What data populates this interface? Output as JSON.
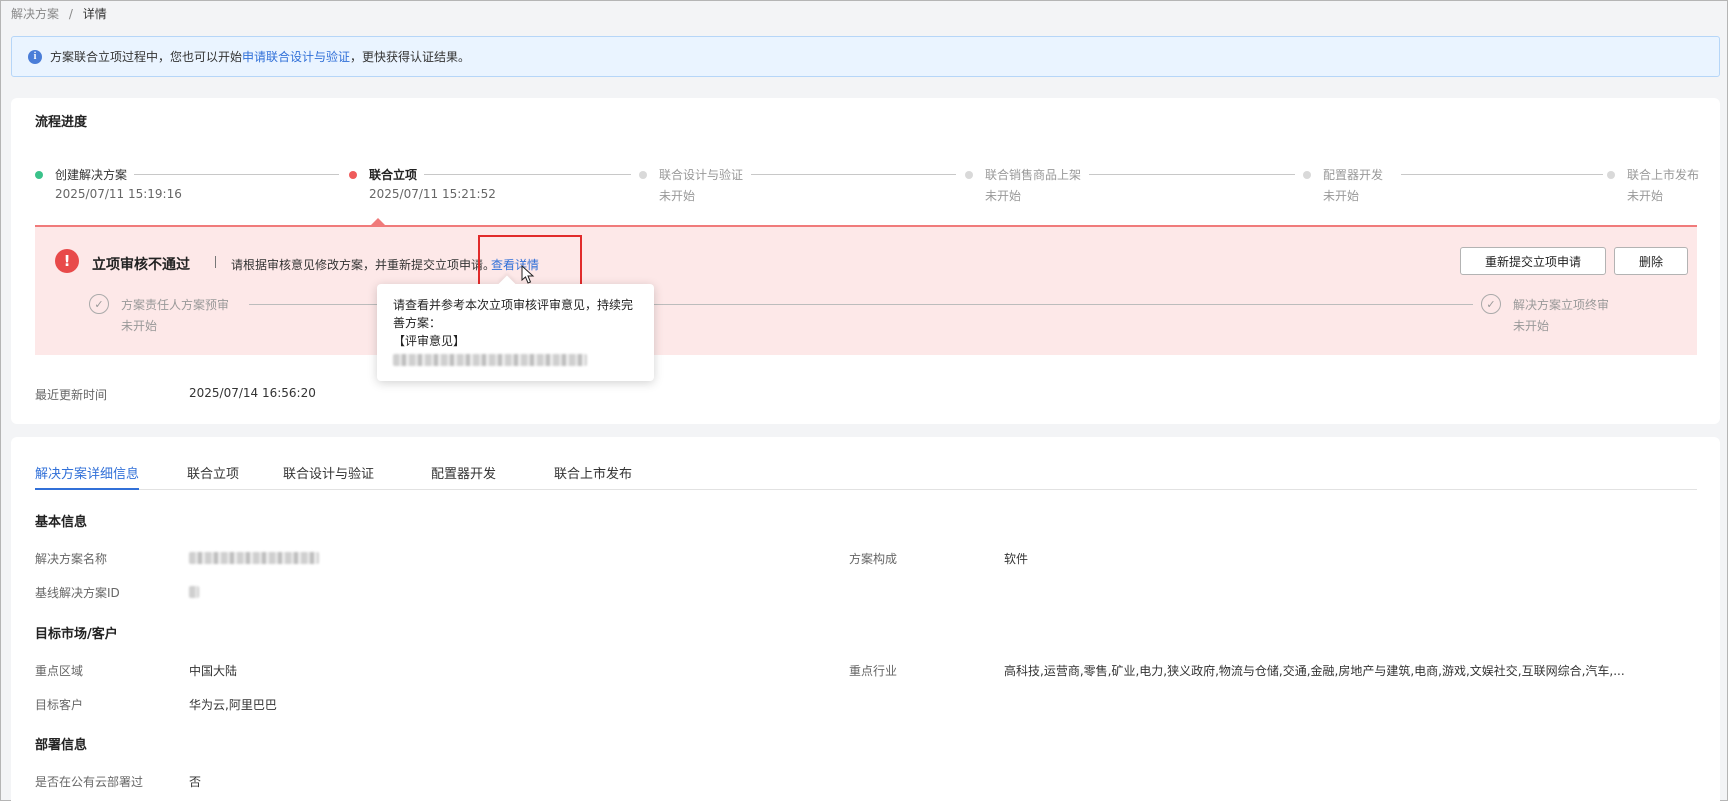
{
  "breadcrumb": {
    "parent": "解决方案",
    "separator": "/",
    "current": "详情"
  },
  "banner": {
    "icon": "info-icon",
    "text_before": "方案联合立项过程中，您也可以开始",
    "link": "申请联合设计与验证",
    "text_after": "，更快获得认证结果。"
  },
  "progress": {
    "title": "流程进度",
    "steps": [
      {
        "title": "创建解决方案",
        "subtitle": "2025/07/11 15:19:16",
        "status": "done",
        "color": "#3ac28a"
      },
      {
        "title": "联合立项",
        "subtitle": "2025/07/11 15:21:52",
        "status": "failed",
        "color": "#ef5b5b"
      },
      {
        "title": "联合设计与验证",
        "subtitle": "未开始",
        "status": "pending"
      },
      {
        "title": "联合销售商品上架",
        "subtitle": "未开始",
        "status": "pending"
      },
      {
        "title": "配置器开发",
        "subtitle": "未开始",
        "status": "pending"
      },
      {
        "title": "联合上市发布",
        "subtitle": "未开始",
        "status": "pending"
      }
    ],
    "error": {
      "icon": "exclamation-icon",
      "title": "立项审核不通过",
      "message": "请根据审核意见修改方案，并重新提交立项申请。",
      "link": "查看详情",
      "buttons": {
        "resubmit": "重新提交立项申请",
        "delete": "删除"
      },
      "sub_steps": [
        {
          "title": "方案责任人方案预审",
          "status": "未开始"
        },
        {
          "title": "解决方案立项终审",
          "status": "未开始"
        }
      ],
      "tooltip": {
        "text": "请查看并参考本次立项审核评审意见，持续完善方案：",
        "label": "【评审意见】"
      }
    },
    "last_update": {
      "label": "最近更新时间",
      "value": "2025/07/14 16:56:20"
    }
  },
  "tabs": [
    "解决方案详细信息",
    "联合立项",
    "联合设计与验证",
    "配置器开发",
    "联合上市发布"
  ],
  "details": {
    "basic_title": "基本信息",
    "solution_name_label": "解决方案名称",
    "composition_label": "方案构成",
    "composition_value": "软件",
    "baseline_id_label": "基线解决方案ID",
    "market_title": "目标市场/客户",
    "region_label": "重点区域",
    "region_value": "中国大陆",
    "industry_label": "重点行业",
    "industry_value": "高科技,运营商,零售,矿业,电力,狭义政府,物流与仓储,交通,金融,房地产与建筑,电商,游戏,文娱社交,互联网综合,汽车,...",
    "customer_label": "目标客户",
    "customer_value": "华为云,阿里巴巴",
    "deploy_title": "部署信息",
    "public_cloud_label": "是否在公有云部署过",
    "public_cloud_value": "否"
  },
  "colors": {
    "accent": "#3170d8",
    "error": "#e84a4a",
    "success": "#3ac28a"
  }
}
